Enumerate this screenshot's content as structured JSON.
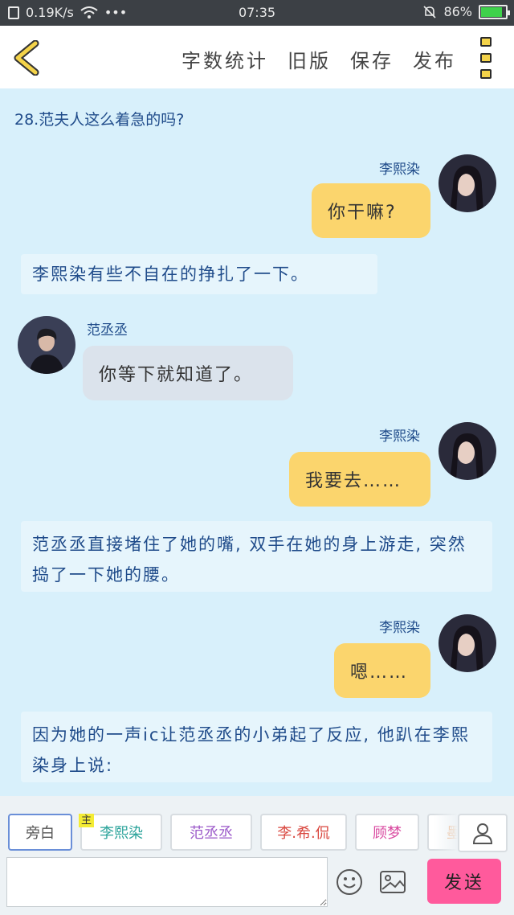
{
  "status_bar": {
    "network_speed": "0.19K/s",
    "time": "07:35",
    "battery": "86%",
    "battery_level": 0.86
  },
  "toolbar": {
    "back_icon": "chevron-left-icon",
    "actions": [
      "字数统计",
      "旧版",
      "保存",
      "发布"
    ],
    "menu_icon": "more-vertical-icon"
  },
  "chapter_title": "28.范夫人这么着急的吗?",
  "messages": [
    {
      "type": "dialog",
      "side": "right",
      "speaker": "李熙染",
      "text": "你干嘛?"
    },
    {
      "type": "narration",
      "text": "李熙染有些不自在的挣扎了一下。"
    },
    {
      "type": "dialog",
      "side": "left",
      "speaker": "范丞丞",
      "text": "你等下就知道了。"
    },
    {
      "type": "dialog",
      "side": "right",
      "speaker": "李熙染",
      "text": "我要去……"
    },
    {
      "type": "narration",
      "text": "范丞丞直接堵住了她的嘴, 双手在她的身上游走, 突然捣了一下她的腰。"
    },
    {
      "type": "dialog",
      "side": "right",
      "speaker": "李熙染",
      "text": "嗯……"
    },
    {
      "type": "narration",
      "text": "因为她的一声ic让范丞丞的小弟起了反应, 他趴在李熙染身上说:"
    }
  ],
  "roles": {
    "main_tag": "主",
    "items": [
      {
        "label": "旁白",
        "color": "#555555",
        "selected": true
      },
      {
        "label": "李熙染",
        "color": "#2aa39a",
        "main": true
      },
      {
        "label": "范丞丞",
        "color": "#9b59c9"
      },
      {
        "label": "李.希.侃",
        "color": "#d9473f"
      },
      {
        "label": "顾梦",
        "color": "#d94aa0"
      },
      {
        "label": "墨",
        "color": "#f08a3c"
      }
    ]
  },
  "composer": {
    "input_value": "",
    "emoji_icon": "smile-icon",
    "image_icon": "image-icon",
    "send_label": "发送",
    "send_color": "#ff5a9c"
  }
}
